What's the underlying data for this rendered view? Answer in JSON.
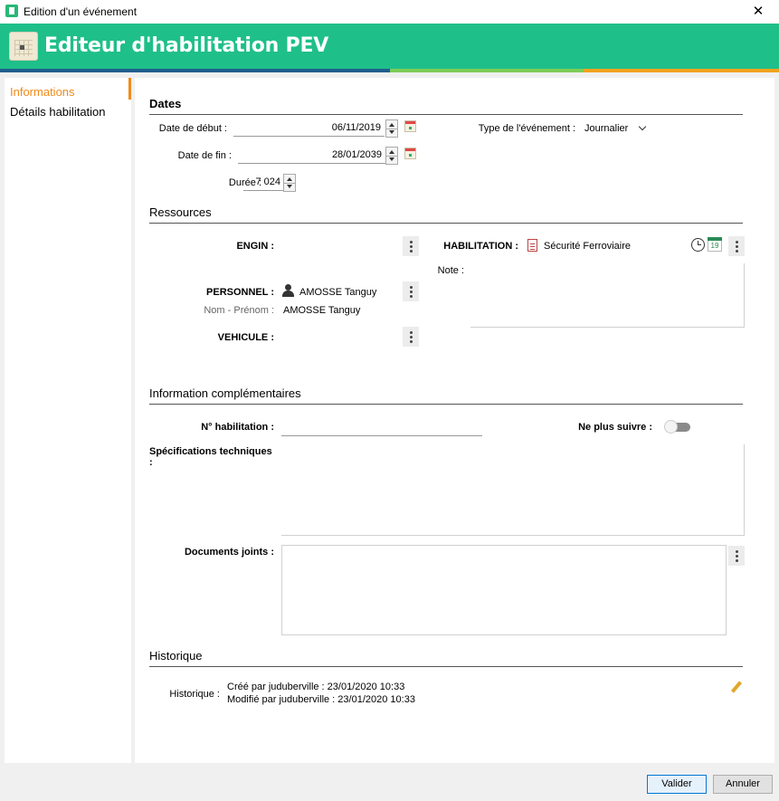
{
  "window": {
    "title": "Edition d'un événement",
    "close_glyph": "✕"
  },
  "banner": {
    "title": "Editeur d'habilitation PEV"
  },
  "colors": {
    "banner": "#1fbf8a",
    "accent": "#f08a1a",
    "stripe_blue": "#1f5e8c",
    "stripe_green": "#7dcc57",
    "stripe_orange": "#f2a21e"
  },
  "sidebar": {
    "items": [
      {
        "label": "Informations",
        "active": true
      },
      {
        "label": "Détails habilitation",
        "active": false
      }
    ]
  },
  "dates": {
    "section_title": "Dates",
    "start_label": "Date de début :",
    "start_value": "06/11/2019",
    "end_label": "Date de fin :",
    "end_value": "28/01/2039",
    "duration_label": "Durée :",
    "duration_value": "7 024",
    "event_type_label": "Type de l'événement :",
    "event_type_value": "Journalier"
  },
  "ressources": {
    "section_title": "Ressources",
    "engin_label": "ENGIN :",
    "personnel_label": "PERSONNEL :",
    "personnel_value": "AMOSSE Tanguy",
    "nom_prenom_label": "Nom - Prénom :",
    "nom_prenom_value": "AMOSSE Tanguy",
    "vehicule_label": "VEHICULE :",
    "habilitation_label": "HABILITATION :",
    "habilitation_value": "Sécurité Ferroviaire",
    "note_label": "Note :",
    "calendar_day": "19"
  },
  "info_comp": {
    "section_title": "Information complémentaires",
    "num_hab_label": "N° habilitation :",
    "num_hab_value": "",
    "ne_plus_suivre_label": "Ne plus suivre :",
    "ne_plus_suivre_on": false,
    "spec_label": "Spécifications techniques :",
    "docs_label": "Documents joints :"
  },
  "historique": {
    "section_title": "Historique",
    "label": "Historique :",
    "created_prefix": "Créé par ",
    "created_value": "juduberville : 23/01/2020 10:33",
    "modified_prefix": "Modifié par ",
    "modified_value": "juduberville : 23/01/2020 10:33"
  },
  "footer": {
    "validate_label": "Valider",
    "cancel_label": "Annuler"
  }
}
